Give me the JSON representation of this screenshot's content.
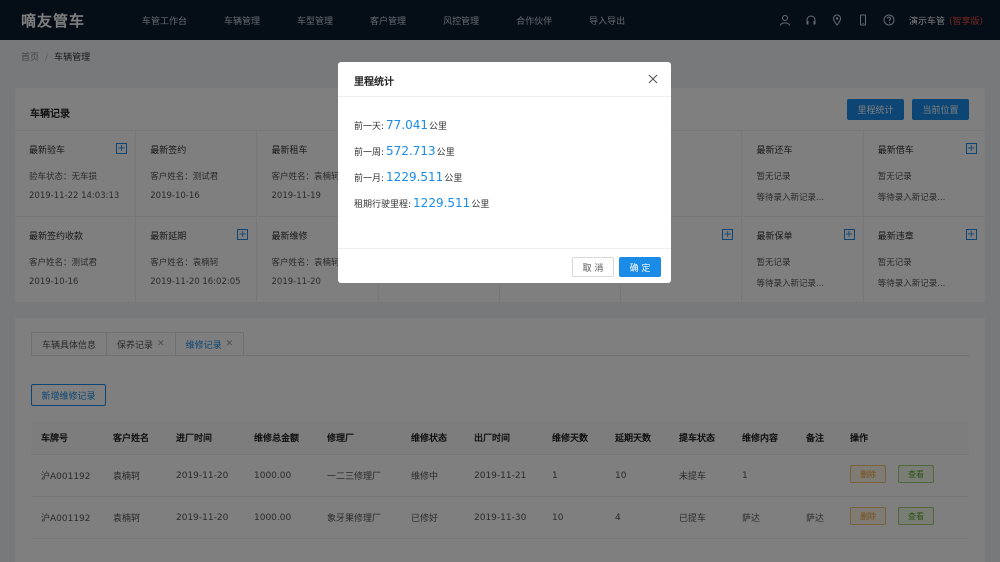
{
  "app": {
    "logo": "嘀友管车",
    "user": "演示车管",
    "edition": "(智享版)"
  },
  "nav": [
    "车管工作台",
    "车辆管理",
    "车型管理",
    "客户管理",
    "风控管理",
    "合作伙伴",
    "导入导出"
  ],
  "breadcrumb": {
    "home": "首页",
    "sep": "/",
    "current": "车辆管理"
  },
  "records": {
    "title": "车辆记录",
    "btn_mileage": "里程统计",
    "btn_location": "当前位置",
    "cells": [
      {
        "h": "最新验车",
        "l2": "验车状态：无车损",
        "l3": "2019-11-22 14:03:13",
        "plus": true
      },
      {
        "h": "最新签约",
        "l2": "客户姓名：测试君",
        "l3": "2019-10-16",
        "plus": false
      },
      {
        "h": "最新租车",
        "l2": "客户姓名：袁楠轲",
        "l3": "2019-11-19",
        "plus": false
      },
      {
        "h": "",
        "l2": "",
        "l3": "",
        "plus": false
      },
      {
        "h": "",
        "l2": "",
        "l3": "",
        "plus": false
      },
      {
        "h": "",
        "l2": "",
        "l3": "...记录...",
        "plus": false
      },
      {
        "h": "最新还车",
        "l2": "暂无记录",
        "l3": "等待录入新记录...",
        "plus": false
      },
      {
        "h": "最新借车",
        "l2": "暂无记录",
        "l3": "等待录入新记录...",
        "plus": true
      },
      {
        "h": "最新签约收款",
        "l2": "客户姓名：测试君",
        "l3": "2019-10-16",
        "plus": false
      },
      {
        "h": "最新延期",
        "l2": "客户姓名：袁楠轲",
        "l3": "2019-11-20 16:02:05",
        "plus": true
      },
      {
        "h": "最新维修",
        "l2": "客户姓名：袁楠轲",
        "l3": "2019-11-20",
        "plus": false
      },
      {
        "h": "",
        "l2": "",
        "l3": "",
        "plus": false
      },
      {
        "h": "",
        "l2": "",
        "l3": "",
        "plus": false
      },
      {
        "h": "",
        "l2": "",
        "l3": "",
        "plus": true
      },
      {
        "h": "最新保单",
        "l2": "暂无记录",
        "l3": "等待录入新记录...",
        "plus": true
      },
      {
        "h": "最新违章",
        "l2": "暂无记录",
        "l3": "等待录入新记录...",
        "plus": true
      }
    ]
  },
  "tabs": [
    {
      "label": "车辆具体信息",
      "closable": false,
      "active": false
    },
    {
      "label": "保养记录",
      "closable": true,
      "active": false
    },
    {
      "label": "维修记录",
      "closable": true,
      "active": true
    }
  ],
  "close_glyph": "✕",
  "add_repair": "新增维修记录",
  "table": {
    "headers": [
      "车牌号",
      "客户姓名",
      "进厂时间",
      "维修总金额",
      "修理厂",
      "维修状态",
      "出厂时间",
      "维修天数",
      "延期天数",
      "提车状态",
      "维修内容",
      "备注",
      "操作"
    ],
    "rows": [
      [
        "沪A001192",
        "袁楠轲",
        "2019-11-20",
        "1000.00",
        "一二三修理厂",
        "维修中",
        "2019-11-21",
        "1",
        "10",
        "未提车",
        "1",
        ""
      ],
      [
        "沪A001192",
        "袁楠轲",
        "2019-11-20",
        "1000.00",
        "象牙果修理厂",
        "已修好",
        "2019-11-30",
        "10",
        "4",
        "已提车",
        "萨达",
        "萨达"
      ]
    ],
    "btn_delete": "删除",
    "btn_view": "查看"
  },
  "modal": {
    "title": "里程统计",
    "rows": [
      {
        "label": "前一天:",
        "value": "77.041",
        "unit": "公里"
      },
      {
        "label": "前一周:",
        "value": "572.713",
        "unit": "公里"
      },
      {
        "label": "前一月:",
        "value": "1229.511",
        "unit": "公里"
      },
      {
        "label": "租期行驶里程:",
        "value": "1229.511",
        "unit": "公里"
      }
    ],
    "cancel": "取 消",
    "ok": "确 定"
  },
  "colors": {
    "topbar": "#0b1a2e",
    "accent": "#1b8be8",
    "edition": "#e84d3d"
  }
}
